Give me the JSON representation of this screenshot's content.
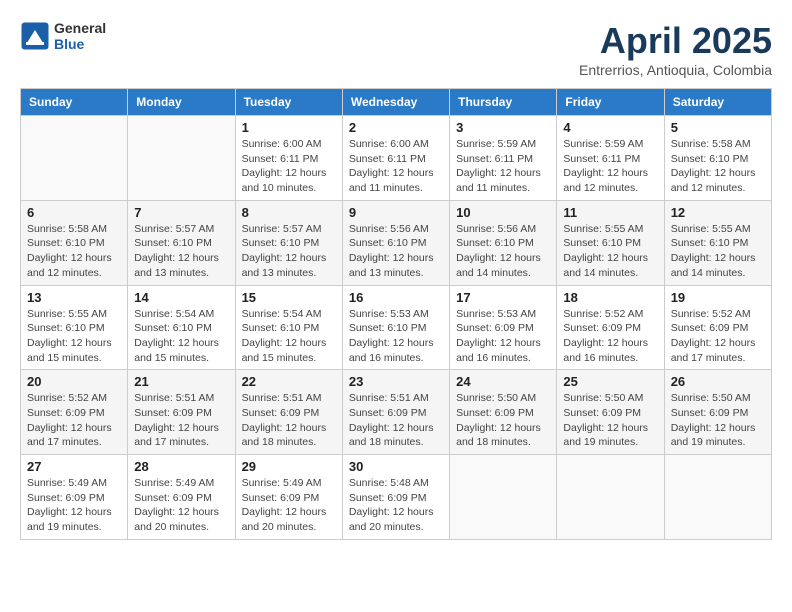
{
  "header": {
    "logo_general": "General",
    "logo_blue": "Blue",
    "month_title": "April 2025",
    "subtitle": "Entrerrios, Antioquia, Colombia"
  },
  "days_of_week": [
    "Sunday",
    "Monday",
    "Tuesday",
    "Wednesday",
    "Thursday",
    "Friday",
    "Saturday"
  ],
  "weeks": [
    [
      {
        "day": "",
        "info": ""
      },
      {
        "day": "",
        "info": ""
      },
      {
        "day": "1",
        "info": "Sunrise: 6:00 AM\nSunset: 6:11 PM\nDaylight: 12 hours and 10 minutes."
      },
      {
        "day": "2",
        "info": "Sunrise: 6:00 AM\nSunset: 6:11 PM\nDaylight: 12 hours and 11 minutes."
      },
      {
        "day": "3",
        "info": "Sunrise: 5:59 AM\nSunset: 6:11 PM\nDaylight: 12 hours and 11 minutes."
      },
      {
        "day": "4",
        "info": "Sunrise: 5:59 AM\nSunset: 6:11 PM\nDaylight: 12 hours and 12 minutes."
      },
      {
        "day": "5",
        "info": "Sunrise: 5:58 AM\nSunset: 6:10 PM\nDaylight: 12 hours and 12 minutes."
      }
    ],
    [
      {
        "day": "6",
        "info": "Sunrise: 5:58 AM\nSunset: 6:10 PM\nDaylight: 12 hours and 12 minutes."
      },
      {
        "day": "7",
        "info": "Sunrise: 5:57 AM\nSunset: 6:10 PM\nDaylight: 12 hours and 13 minutes."
      },
      {
        "day": "8",
        "info": "Sunrise: 5:57 AM\nSunset: 6:10 PM\nDaylight: 12 hours and 13 minutes."
      },
      {
        "day": "9",
        "info": "Sunrise: 5:56 AM\nSunset: 6:10 PM\nDaylight: 12 hours and 13 minutes."
      },
      {
        "day": "10",
        "info": "Sunrise: 5:56 AM\nSunset: 6:10 PM\nDaylight: 12 hours and 14 minutes."
      },
      {
        "day": "11",
        "info": "Sunrise: 5:55 AM\nSunset: 6:10 PM\nDaylight: 12 hours and 14 minutes."
      },
      {
        "day": "12",
        "info": "Sunrise: 5:55 AM\nSunset: 6:10 PM\nDaylight: 12 hours and 14 minutes."
      }
    ],
    [
      {
        "day": "13",
        "info": "Sunrise: 5:55 AM\nSunset: 6:10 PM\nDaylight: 12 hours and 15 minutes."
      },
      {
        "day": "14",
        "info": "Sunrise: 5:54 AM\nSunset: 6:10 PM\nDaylight: 12 hours and 15 minutes."
      },
      {
        "day": "15",
        "info": "Sunrise: 5:54 AM\nSunset: 6:10 PM\nDaylight: 12 hours and 15 minutes."
      },
      {
        "day": "16",
        "info": "Sunrise: 5:53 AM\nSunset: 6:10 PM\nDaylight: 12 hours and 16 minutes."
      },
      {
        "day": "17",
        "info": "Sunrise: 5:53 AM\nSunset: 6:09 PM\nDaylight: 12 hours and 16 minutes."
      },
      {
        "day": "18",
        "info": "Sunrise: 5:52 AM\nSunset: 6:09 PM\nDaylight: 12 hours and 16 minutes."
      },
      {
        "day": "19",
        "info": "Sunrise: 5:52 AM\nSunset: 6:09 PM\nDaylight: 12 hours and 17 minutes."
      }
    ],
    [
      {
        "day": "20",
        "info": "Sunrise: 5:52 AM\nSunset: 6:09 PM\nDaylight: 12 hours and 17 minutes."
      },
      {
        "day": "21",
        "info": "Sunrise: 5:51 AM\nSunset: 6:09 PM\nDaylight: 12 hours and 17 minutes."
      },
      {
        "day": "22",
        "info": "Sunrise: 5:51 AM\nSunset: 6:09 PM\nDaylight: 12 hours and 18 minutes."
      },
      {
        "day": "23",
        "info": "Sunrise: 5:51 AM\nSunset: 6:09 PM\nDaylight: 12 hours and 18 minutes."
      },
      {
        "day": "24",
        "info": "Sunrise: 5:50 AM\nSunset: 6:09 PM\nDaylight: 12 hours and 18 minutes."
      },
      {
        "day": "25",
        "info": "Sunrise: 5:50 AM\nSunset: 6:09 PM\nDaylight: 12 hours and 19 minutes."
      },
      {
        "day": "26",
        "info": "Sunrise: 5:50 AM\nSunset: 6:09 PM\nDaylight: 12 hours and 19 minutes."
      }
    ],
    [
      {
        "day": "27",
        "info": "Sunrise: 5:49 AM\nSunset: 6:09 PM\nDaylight: 12 hours and 19 minutes."
      },
      {
        "day": "28",
        "info": "Sunrise: 5:49 AM\nSunset: 6:09 PM\nDaylight: 12 hours and 20 minutes."
      },
      {
        "day": "29",
        "info": "Sunrise: 5:49 AM\nSunset: 6:09 PM\nDaylight: 12 hours and 20 minutes."
      },
      {
        "day": "30",
        "info": "Sunrise: 5:48 AM\nSunset: 6:09 PM\nDaylight: 12 hours and 20 minutes."
      },
      {
        "day": "",
        "info": ""
      },
      {
        "day": "",
        "info": ""
      },
      {
        "day": "",
        "info": ""
      }
    ]
  ]
}
